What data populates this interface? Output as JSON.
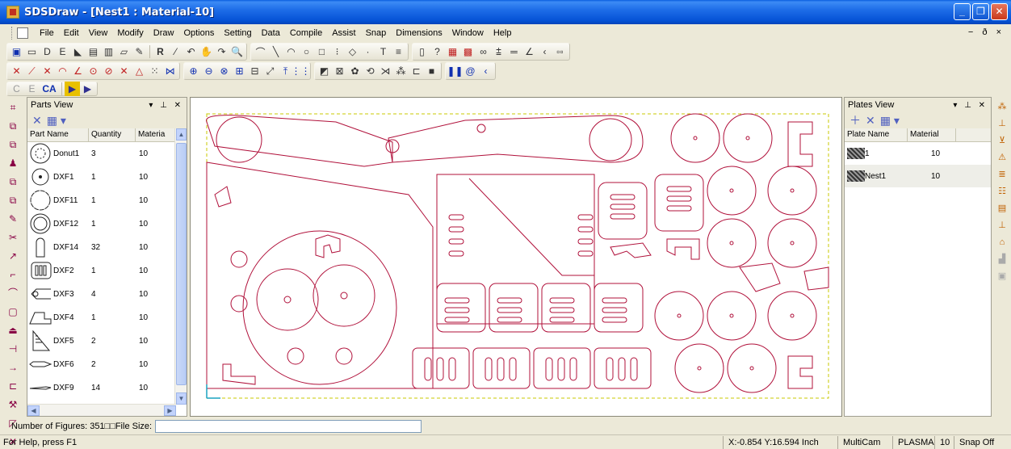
{
  "window": {
    "title": "SDSDraw - [Nest1 : Material-10]"
  },
  "menu": {
    "items": [
      "File",
      "Edit",
      "View",
      "Modify",
      "Draw",
      "Options",
      "Setting",
      "Data",
      "Compile",
      "Assist",
      "Snap",
      "Dimensions",
      "Window",
      "Help"
    ],
    "mdi_controls": "- ð ×"
  },
  "toolbar3": {
    "c_label": "C",
    "e_label": "E",
    "ca_label": "CA"
  },
  "parts_view": {
    "title": "Parts View",
    "columns": [
      "Part Name",
      "Quantity",
      "Materia"
    ],
    "rows": [
      {
        "name": "Donut1",
        "qty": "3",
        "mat": "10"
      },
      {
        "name": "DXF1",
        "qty": "1",
        "mat": "10"
      },
      {
        "name": "DXF11",
        "qty": "1",
        "mat": "10"
      },
      {
        "name": "DXF12",
        "qty": "1",
        "mat": "10"
      },
      {
        "name": "DXF14",
        "qty": "32",
        "mat": "10"
      },
      {
        "name": "DXF2",
        "qty": "1",
        "mat": "10"
      },
      {
        "name": "DXF3",
        "qty": "4",
        "mat": "10"
      },
      {
        "name": "DXF4",
        "qty": "1",
        "mat": "10"
      },
      {
        "name": "DXF5",
        "qty": "2",
        "mat": "10"
      },
      {
        "name": "DXF6",
        "qty": "2",
        "mat": "10"
      },
      {
        "name": "DXF9",
        "qty": "14",
        "mat": "10"
      }
    ]
  },
  "plates_view": {
    "title": "Plates View",
    "columns": [
      "Plate Name",
      "Material"
    ],
    "rows": [
      {
        "name": "1",
        "mat": "10"
      },
      {
        "name": "Nest1",
        "mat": "10"
      }
    ]
  },
  "command_bar": {
    "label": "Number of Figures: 351□□File Size:",
    "value": ""
  },
  "status": {
    "help": "For Help, press F1",
    "coords": "X:-0.854 Y:16.594 Inch",
    "machine": "MultiCam",
    "process": "PLASMA",
    "material": "10",
    "snap": "Snap Off"
  },
  "colors": {
    "part_outline": "#B0103A",
    "plate_border": "#C8C800",
    "title_blue": "#0A5FDF"
  }
}
